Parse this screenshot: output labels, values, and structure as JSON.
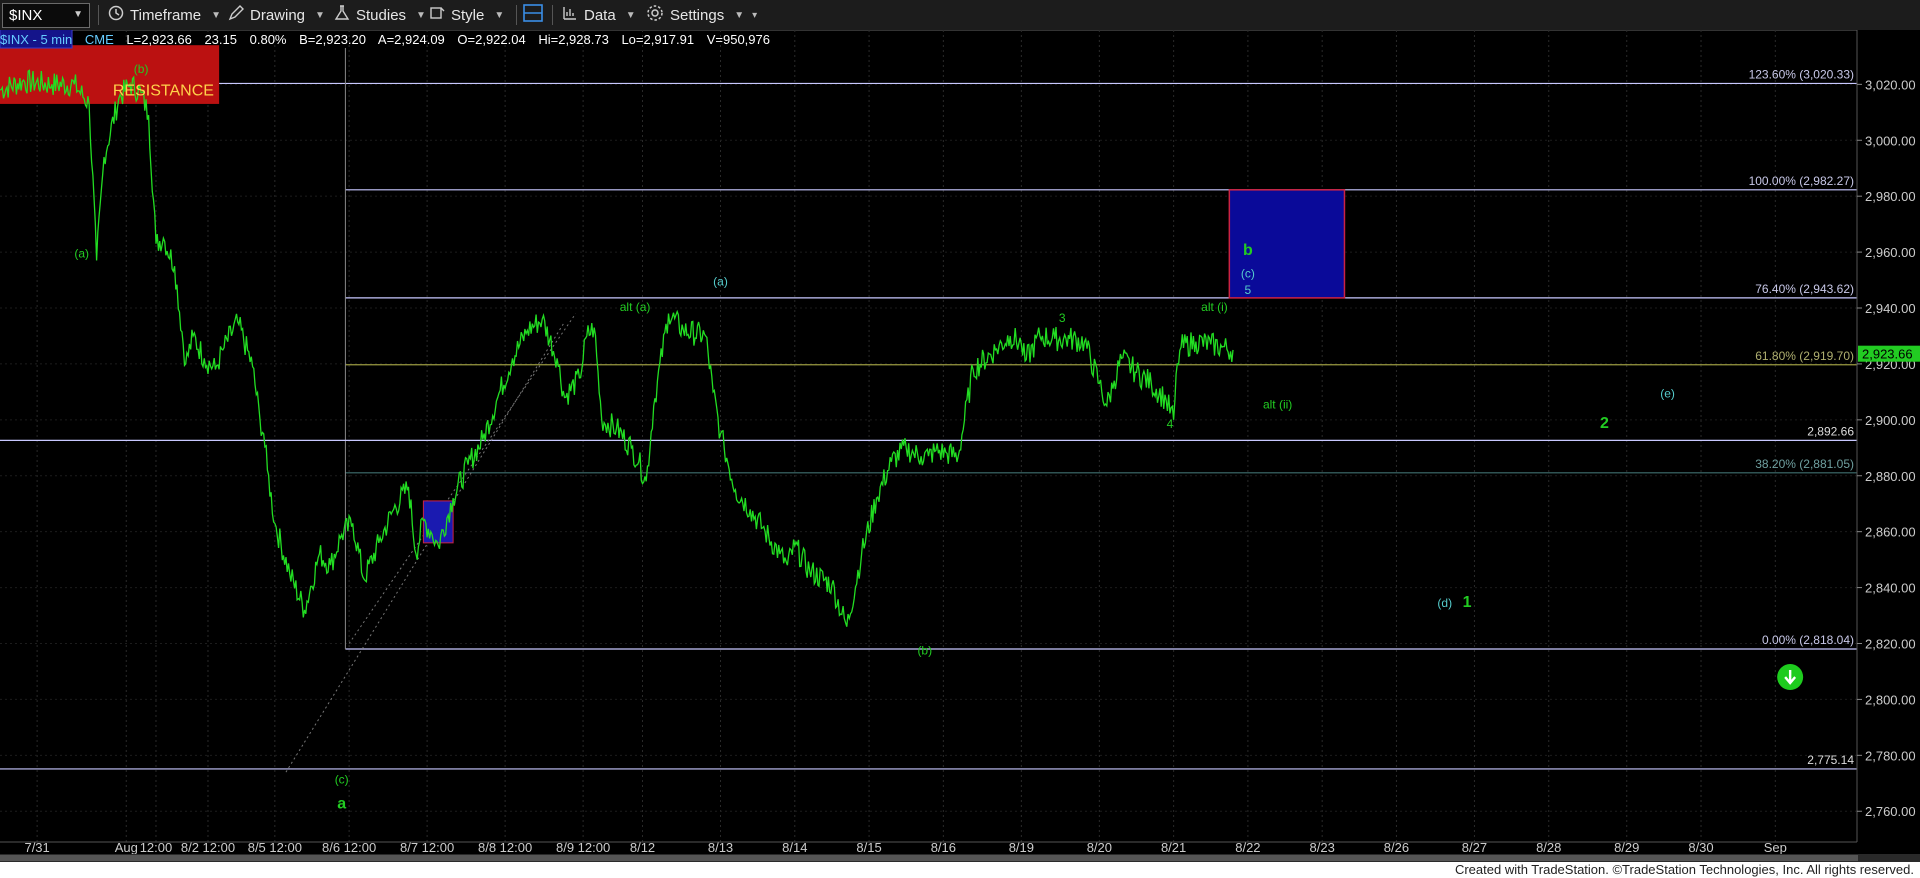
{
  "toolbar": {
    "symbol": "$INX",
    "timeframe": "Timeframe",
    "drawing": "Drawing",
    "studies": "Studies",
    "style": "Style",
    "data": "Data",
    "settings": "Settings"
  },
  "infobar": {
    "symbol_interval": "$INX - 5 min",
    "exchange": "CME",
    "last": "L=2,923.66",
    "change": "23.15",
    "change_pct": "0.80%",
    "bid": "B=2,923.20",
    "ask": "A=2,924.09",
    "open": "O=2,922.04",
    "high": "Hi=2,928.73",
    "low": "Lo=2,917.91",
    "volume": "V=950,976"
  },
  "footer": {
    "text": "Created with TradeStation. ©TradeStation Technologies, Inc. All rights reserved."
  },
  "colors": {
    "price": "#22dd22",
    "wave_green": "#22cc22",
    "wave_cyan": "#55cccc",
    "axis_text": "#cccccc",
    "last_price_bg": "#22cc22",
    "resistance_box": "#bb1111",
    "target_box": "#0a0a99",
    "target_border": "#cc2244",
    "fib_line": "#c8c8ff",
    "fib_61_line": "#9a9a40",
    "fib_38_line": "#3f6f6f"
  },
  "chart_data": {
    "type": "line",
    "title": "",
    "xlabel": "",
    "ylabel": "",
    "ylim": [
      2749,
      3033
    ],
    "xlim": [
      0,
      25
    ],
    "grid": true,
    "y_ticks": [
      2760,
      2780,
      2800,
      2820,
      2840,
      2860,
      2880,
      2900,
      2920,
      2940,
      2960,
      2980,
      3000,
      3020
    ],
    "y_tick_labels": [
      "2,760.00",
      "2,780.00",
      "2,800.00",
      "2,820.00",
      "2,840.00",
      "2,860.00",
      "2,880.00",
      "2,900.00",
      "2,920.00",
      "2,940.00",
      "2,960.00",
      "2,980.00",
      "3,000.00",
      "3,020.00"
    ],
    "x_ticks": [
      {
        "t": 0.5,
        "label": "7/31"
      },
      {
        "t": 1.7,
        "label": "Aug"
      },
      {
        "t": 2.1,
        "label": "12:00"
      },
      {
        "t": 2.8,
        "label": "8/2 12:00"
      },
      {
        "t": 3.7,
        "label": "8/5 12:00"
      },
      {
        "t": 4.7,
        "label": "8/6 12:00"
      },
      {
        "t": 5.75,
        "label": "8/7 12:00"
      },
      {
        "t": 6.8,
        "label": "8/8 12:00"
      },
      {
        "t": 7.85,
        "label": "8/9 12:00"
      },
      {
        "t": 8.65,
        "label": "8/12"
      },
      {
        "t": 9.7,
        "label": "8/13"
      },
      {
        "t": 10.7,
        "label": "8/14"
      },
      {
        "t": 11.7,
        "label": "8/15"
      },
      {
        "t": 12.7,
        "label": "8/16"
      },
      {
        "t": 13.75,
        "label": "8/19"
      },
      {
        "t": 14.8,
        "label": "8/20"
      },
      {
        "t": 15.8,
        "label": "8/21"
      },
      {
        "t": 16.8,
        "label": "8/22"
      },
      {
        "t": 17.8,
        "label": "8/23"
      },
      {
        "t": 18.8,
        "label": "8/26"
      },
      {
        "t": 19.85,
        "label": "8/27"
      },
      {
        "t": 20.85,
        "label": "8/28"
      },
      {
        "t": 21.9,
        "label": "8/29"
      },
      {
        "t": 22.9,
        "label": "8/30"
      },
      {
        "t": 23.9,
        "label": "Sep"
      }
    ],
    "series": [
      {
        "x": [
          0,
          0.3,
          0.7,
          1.0,
          1.2,
          1.3,
          1.4,
          1.6,
          1.75,
          1.9,
          2.0,
          2.1,
          2.2,
          2.35,
          2.5,
          2.6,
          2.75,
          2.9,
          3.0,
          3.2,
          3.4,
          3.5,
          3.55,
          3.6,
          3.7,
          3.9,
          4.1,
          4.3,
          4.45,
          4.6,
          4.75,
          4.9,
          5.1,
          5.3,
          5.5,
          5.6,
          5.7,
          5.8,
          5.9,
          6.1,
          6.3,
          6.5,
          6.7,
          6.9,
          7.1,
          7.3,
          7.5,
          7.6,
          7.8,
          7.9,
          8.0,
          8.1,
          8.3,
          8.5,
          8.6,
          8.7,
          8.8,
          9.0,
          9.2,
          9.5,
          9.6,
          9.7,
          9.75,
          9.9,
          10.1,
          10.3,
          10.5,
          10.6,
          10.7,
          10.9,
          11.2,
          11.4,
          11.6,
          11.8,
          12.0,
          12.2,
          12.3,
          12.4,
          12.5,
          12.6,
          12.75,
          12.9,
          13.1,
          13.4,
          13.6,
          13.75,
          13.8,
          14.0,
          14.2,
          14.4,
          14.6,
          14.8,
          14.9,
          15.0,
          15.1,
          15.3,
          15.5,
          15.7,
          15.8,
          15.85,
          15.9,
          16.1,
          16.3,
          16.45,
          16.6
        ],
        "y": [
          3018,
          3021,
          3020,
          3020,
          3013,
          2957,
          2994,
          3015,
          3020,
          3017,
          3009,
          2963,
          2965,
          2955,
          2920,
          2930,
          2922,
          2918,
          2925,
          2935,
          2919,
          2900,
          2895,
          2882,
          2863,
          2845,
          2832,
          2852,
          2848,
          2859,
          2863,
          2843,
          2856,
          2868,
          2876,
          2852,
          2864,
          2860,
          2855,
          2872,
          2884,
          2893,
          2908,
          2922,
          2932,
          2936,
          2922,
          2908,
          2915,
          2930,
          2933,
          2900,
          2897,
          2890,
          2885,
          2878,
          2905,
          2938,
          2932,
          2930,
          2910,
          2895,
          2890,
          2875,
          2868,
          2860,
          2852,
          2848,
          2855,
          2846,
          2841,
          2826,
          2852,
          2872,
          2885,
          2890,
          2888,
          2887,
          2887,
          2889,
          2888,
          2887,
          2918,
          2925,
          2930,
          2927,
          2921,
          2930,
          2929,
          2929,
          2928,
          2913,
          2905,
          2914,
          2922,
          2917,
          2913,
          2907,
          2900,
          2920,
          2926,
          2928,
          2927,
          2926,
          2925
        ]
      }
    ],
    "fib_levels": [
      {
        "label": "123.60% (3,020.33)",
        "value": 3020.33
      },
      {
        "label": "100.00% (2,982.27)",
        "value": 2982.27
      },
      {
        "label": "76.40% (2,943.62)",
        "value": 2943.62
      },
      {
        "label": "61.80% (2,919.70)",
        "value": 2919.7
      },
      {
        "label": "38.20% (2,881.05)",
        "value": 2881.05
      },
      {
        "label": "0.00% (2,818.04)",
        "value": 2818.04
      }
    ],
    "horizontal_lines": [
      {
        "label": "2,892.66",
        "value": 2892.66
      },
      {
        "label": "2,775.14",
        "value": 2775.14
      }
    ],
    "last_price": {
      "label": "2,923.66",
      "value": 2923.66
    },
    "annotations": [
      {
        "text": "RESISTANCE",
        "x": 2.2,
        "y": 3016
      },
      {
        "text": "(a)",
        "x": 1.1,
        "y": 2958
      },
      {
        "text": "(b)",
        "x": 1.9,
        "y": 3024
      },
      {
        "text": "(c)",
        "x": 4.6,
        "y": 2770
      },
      {
        "text": "a",
        "x": 4.6,
        "y": 2761
      },
      {
        "text": "alt (a)",
        "x": 8.55,
        "y": 2939
      },
      {
        "text": "(a)",
        "x": 9.7,
        "y": 2948
      },
      {
        "text": "(b)",
        "x": 12.45,
        "y": 2816
      },
      {
        "text": "3",
        "x": 14.3,
        "y": 2935
      },
      {
        "text": "4",
        "x": 15.75,
        "y": 2897
      },
      {
        "text": "alt (i)",
        "x": 16.35,
        "y": 2939
      },
      {
        "text": "alt (ii)",
        "x": 17.2,
        "y": 2904
      },
      {
        "text": "b",
        "x": 16.8,
        "y": 2959
      },
      {
        "text": "(c)",
        "x": 16.8,
        "y": 2951
      },
      {
        "text": "5",
        "x": 16.8,
        "y": 2945
      },
      {
        "text": "(e)",
        "x": 22.45,
        "y": 2908
      },
      {
        "text": "2",
        "x": 21.6,
        "y": 2897
      },
      {
        "text": "(d)",
        "x": 19.45,
        "y": 2833
      },
      {
        "text": "1",
        "x": 19.75,
        "y": 2833
      }
    ]
  }
}
